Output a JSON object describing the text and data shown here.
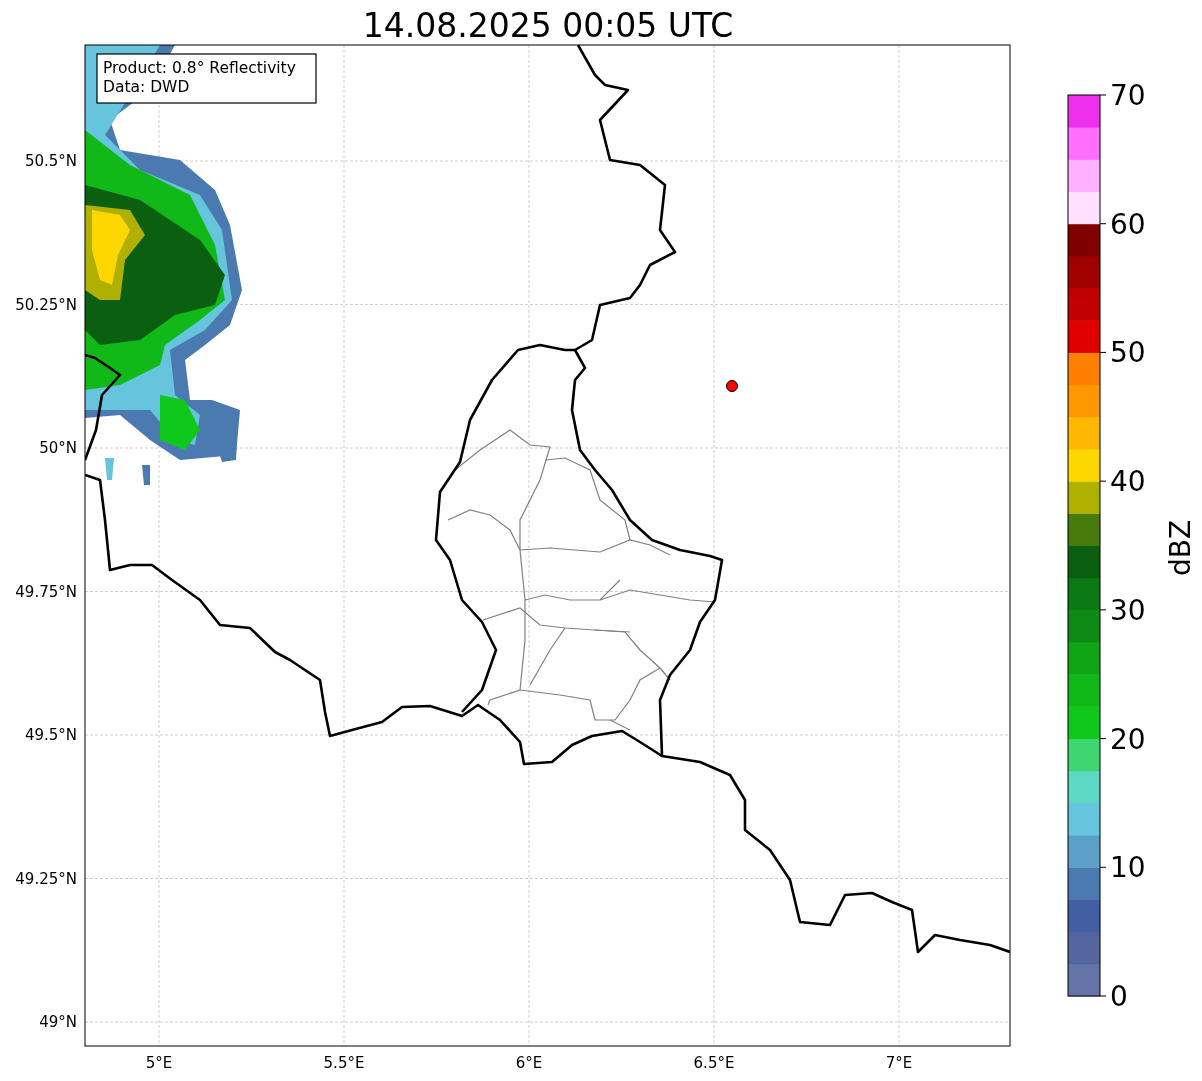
{
  "title": "14.08.2025 00:05 UTC",
  "info_box": [
    "Product: 0.8° Reflectivity",
    "Data: DWD"
  ],
  "y_ticks": [
    "50.5°N",
    "50.25°N",
    "50°N",
    "49.75°N",
    "49.5°N",
    "49.25°N",
    "49°N"
  ],
  "x_ticks": [
    "5°E",
    "5.5°E",
    "6°E",
    "6.5°E",
    "7°E"
  ],
  "colorbar": {
    "label": "dBZ",
    "ticks": [
      "70",
      "60",
      "50",
      "40",
      "30",
      "20",
      "10",
      "0"
    ],
    "segments": [
      {
        "color": "#6474a8"
      },
      {
        "color": "#5366a0"
      },
      {
        "color": "#425fa3"
      },
      {
        "color": "#4a7ab0"
      },
      {
        "color": "#5ba0c8"
      },
      {
        "color": "#66c4dc"
      },
      {
        "color": "#5cd8c4"
      },
      {
        "color": "#3dd671"
      },
      {
        "color": "#10c81c"
      },
      {
        "color": "#10b918"
      },
      {
        "color": "#10a515"
      },
      {
        "color": "#0f8b15"
      },
      {
        "color": "#0c7a13"
      },
      {
        "color": "#0a6010"
      },
      {
        "color": "#487a0c"
      },
      {
        "color": "#b0b000"
      },
      {
        "color": "#ffd700"
      },
      {
        "color": "#ffb800"
      },
      {
        "color": "#ff9800"
      },
      {
        "color": "#ff7f00"
      },
      {
        "color": "#e00000"
      },
      {
        "color": "#c00000"
      },
      {
        "color": "#a00000"
      },
      {
        "color": "#800000"
      },
      {
        "color": "#ffe0ff"
      },
      {
        "color": "#ffb0ff"
      },
      {
        "color": "#ff6eff"
      },
      {
        "color": "#ee30ee"
      }
    ]
  }
}
